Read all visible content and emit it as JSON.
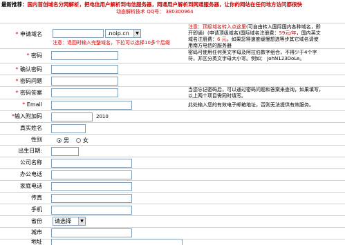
{
  "topbar": {
    "prefix": "最新推荐：",
    "text": "国内首创域名分网解析，把电信用户解析到电信服务器，网通用户解析到网通服务器，让你的网站在任何地方访问都很快",
    "sub": "动态解析技术 QQ号： 380300964"
  },
  "colors": {
    "accent": "#d00000",
    "border": "#7f9db9"
  },
  "domain": {
    "label": "申请域名",
    "input_value": "",
    "select_value": ".noip.cn",
    "warning": "注意：退回时输入完整域名，下拉可以选择10多个后缀",
    "note_lines": [
      [
        "注意：",
        "顶级域名转入点这里",
        "(可自由转入国际国内各种域名，即"
      ],
      [
        "开即通）(申请顶级域名)国际域名注册费：",
        "59元/年",
        "，国内英文"
      ],
      [
        "域名注册费：",
        "6 元",
        "。如果您得速度缓慢想选等步其它域名请使"
      ],
      [
        "用南方电信的服务器",
        "",
        ""
      ]
    ]
  },
  "password": {
    "label": "密码",
    "note_lines": [
      "密码可使用任何英文字母及阿拉伯数字组合，不得少于4个字",
      "符，并区分英文字母大小写。例如： JohN123DoLe。"
    ]
  },
  "confirm": {
    "label": "确认密码"
  },
  "question": {
    "label": "密码问题"
  },
  "answer": {
    "label": "密码答案",
    "note_lines": [
      "当您忘记密码后，可以通过密码问题和答案来查询，如果填写，",
      "以上两个项目需同时填写。"
    ]
  },
  "email": {
    "label": "Email",
    "note": "此处输入您的有效电子邮箱地址，否则无法提供有效服务。"
  },
  "code": {
    "label": "输入附加码",
    "value": "2010"
  },
  "realname": {
    "label": "真实姓名"
  },
  "gender": {
    "label": "性别",
    "options": [
      "男",
      "女"
    ],
    "selected": "男"
  },
  "birthday": {
    "label": "出生日期:"
  },
  "company": {
    "label": "公司名称"
  },
  "office_phone": {
    "label": "办公电话"
  },
  "home_phone": {
    "label": "家庭电话"
  },
  "fax": {
    "label": "传真"
  },
  "mobile": {
    "label": "手机"
  },
  "province": {
    "label": "省份",
    "select_value": "请选择"
  },
  "city": {
    "label": "城市"
  },
  "address": {
    "label": "地址"
  }
}
